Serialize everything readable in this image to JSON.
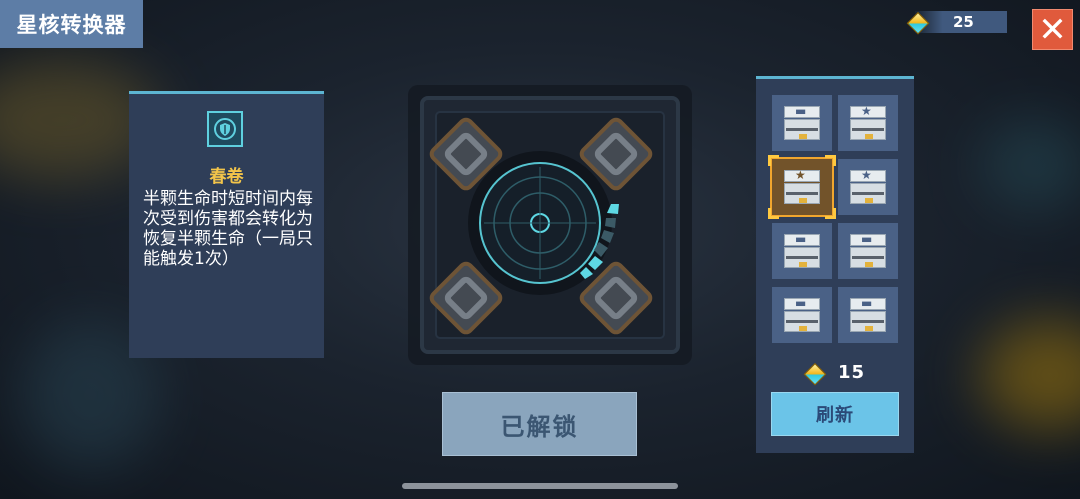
{
  "header": {
    "title": "星核转换器",
    "currency_amount": "25",
    "close_label": "✕"
  },
  "info_panel": {
    "icon": "shield-icon",
    "name": "春卷",
    "description": "半颗生命时短时间内每次受到伤害都会转化为恢复半颗生命（一局只能触发1次）"
  },
  "machine": {
    "progress_segments_lit": 3,
    "progress_segments_total": 6,
    "accent_color": "#5ed8e4"
  },
  "main_button": {
    "label": "已解锁"
  },
  "shop": {
    "slots": [
      {
        "emblem": "gun",
        "selected": false
      },
      {
        "emblem": "star",
        "selected": false
      },
      {
        "emblem": "star",
        "selected": true
      },
      {
        "emblem": "star",
        "selected": false
      },
      {
        "emblem": "gun",
        "selected": false
      },
      {
        "emblem": "gun",
        "selected": false
      },
      {
        "emblem": "gun",
        "selected": false
      },
      {
        "emblem": "gun",
        "selected": false
      }
    ],
    "price": "15",
    "refresh_label": "刷新"
  },
  "colors": {
    "panel": "#2f3e58",
    "panel_border": "#5db5d2",
    "title_bg": "#5d7da6",
    "close_bg": "#e05a3c",
    "gold_text": "#f3c54a",
    "refresh_bg": "#6bc4e8"
  }
}
